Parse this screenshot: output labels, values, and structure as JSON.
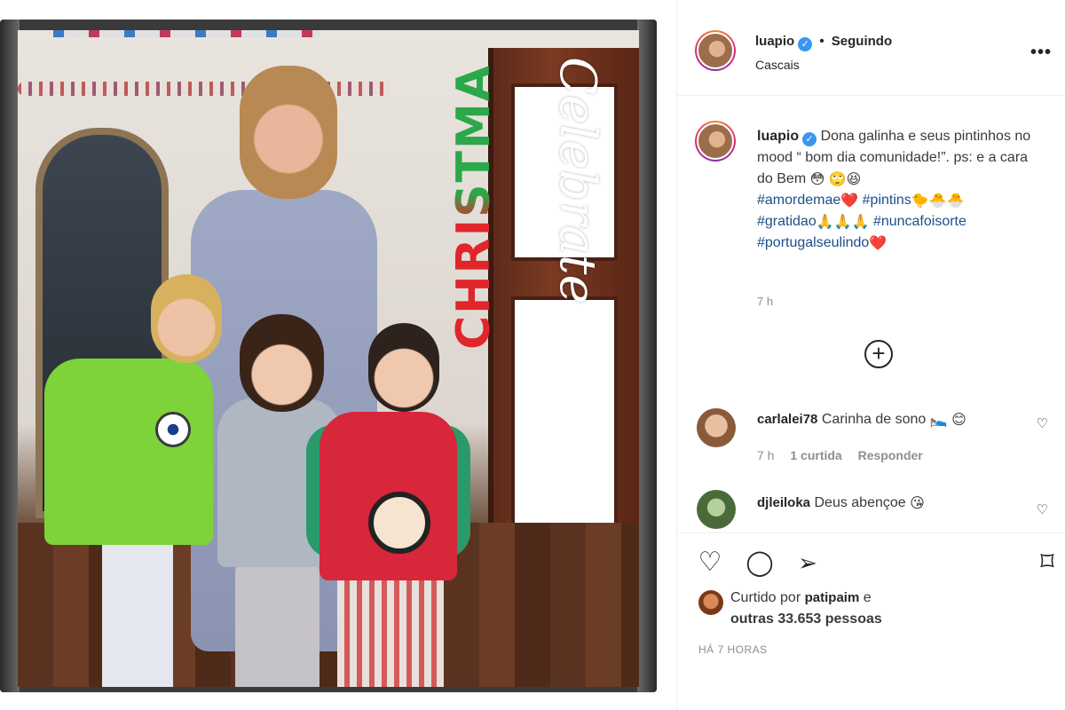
{
  "photo": {
    "overlay_christmas": "CHRISTMAS",
    "overlay_celebrate": "Celebrate"
  },
  "header": {
    "username": "luapio",
    "separator": "•",
    "follow_status": "Seguindo",
    "location": "Cascais",
    "more": "•••"
  },
  "caption": {
    "username": "luapio",
    "text": "Dona galinha e seus pintinhos no mood “ bom dia comunidade!”. ps: e a cara do Bem",
    "text_emojis": "😳 🙄😆",
    "hashtags": [
      {
        "tag": "#amordemae",
        "emoji": "❤️"
      },
      {
        "tag": "#pintins",
        "emoji": "🐤🐣🐣"
      },
      {
        "tag": "#gratidao",
        "emoji": "🙏🙏🙏"
      },
      {
        "tag": "#nuncafoisorte",
        "emoji": ""
      },
      {
        "tag": "#portugalseulindo",
        "emoji": "❤️"
      }
    ],
    "time": "7 h"
  },
  "load_more": "+",
  "comments": [
    {
      "username": "carlalei78",
      "text": "Carinha de sono",
      "emoji": "🛌 😊",
      "time": "7 h",
      "likes": "1 curtida",
      "reply": "Responder",
      "avatar_color": "#b07a55"
    },
    {
      "username": "djleiloka",
      "text": "Deus abençoe",
      "emoji": "😘",
      "avatar_color": "#6a8a55"
    }
  ],
  "actions": {
    "like_icon": "♡",
    "comment_icon": "◯",
    "share_icon": "➢",
    "save_icon": "⌑"
  },
  "likes": {
    "prefix": "Curtido por",
    "user": "patipaim",
    "suffix": "e",
    "others": "outras 33.653 pessoas"
  },
  "timestamp": "HÁ 7 HORAS",
  "colors": {
    "text": "#262626",
    "muted": "#8e8e8e",
    "link": "#1c4f8a",
    "verified": "#3897f0"
  }
}
